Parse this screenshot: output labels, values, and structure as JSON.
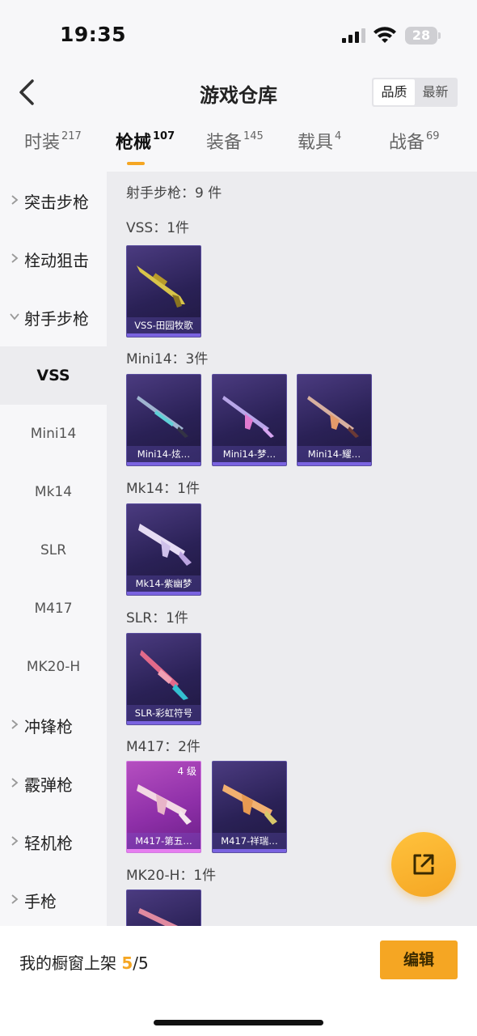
{
  "status": {
    "time": "19:35",
    "battery": "28"
  },
  "nav": {
    "title": "游戏仓库",
    "sort_quality": "品质",
    "sort_newest": "最新"
  },
  "tabs": [
    {
      "label": "时装",
      "count": "217"
    },
    {
      "label": "枪械",
      "count": "107"
    },
    {
      "label": "装备",
      "count": "145"
    },
    {
      "label": "载具",
      "count": "4"
    },
    {
      "label": "战备",
      "count": "69"
    }
  ],
  "sidebar": {
    "items": [
      {
        "label": "突击步枪"
      },
      {
        "label": "栓动狙击"
      },
      {
        "label": "射手步枪"
      },
      {
        "label": "VSS"
      },
      {
        "label": "Mini14"
      },
      {
        "label": "Mk14"
      },
      {
        "label": "SLR"
      },
      {
        "label": "M417"
      },
      {
        "label": "MK20-H"
      },
      {
        "label": "冲锋枪"
      },
      {
        "label": "霰弹枪"
      },
      {
        "label": "轻机枪"
      },
      {
        "label": "手枪"
      }
    ]
  },
  "content": {
    "total": "射手步枪：9 件",
    "groups": [
      {
        "label": "VSS：1件",
        "items": [
          {
            "name": "VSS-田园牧歌"
          }
        ]
      },
      {
        "label": "Mini14：3件",
        "items": [
          {
            "name": "Mini14-炫…"
          },
          {
            "name": "Mini14-梦…"
          },
          {
            "name": "Mini14-耀…"
          }
        ]
      },
      {
        "label": "Mk14：1件",
        "items": [
          {
            "name": "Mk14-紫幽梦"
          }
        ]
      },
      {
        "label": "SLR：1件",
        "items": [
          {
            "name": "SLR-彩虹符号"
          }
        ]
      },
      {
        "label": "M417：2件",
        "items": [
          {
            "name": "M417-第五…",
            "level": "4 级"
          },
          {
            "name": "M417-祥瑞…"
          }
        ]
      },
      {
        "label": "MK20-H：1件",
        "items": []
      }
    ]
  },
  "bottom": {
    "shelf_label": "我的橱窗上架",
    "shelf_count": "5",
    "shelf_total": "/5",
    "edit": "编辑"
  },
  "colors": {
    "accent": "#f5a623",
    "card_purple": "#2a2156",
    "card_pink": "#b54fc0"
  },
  "icons": [
    "back-arrow-icon",
    "signal-icon",
    "wifi-icon",
    "battery-icon",
    "chevron-right-icon",
    "chevron-down-icon",
    "share-external-icon"
  ]
}
